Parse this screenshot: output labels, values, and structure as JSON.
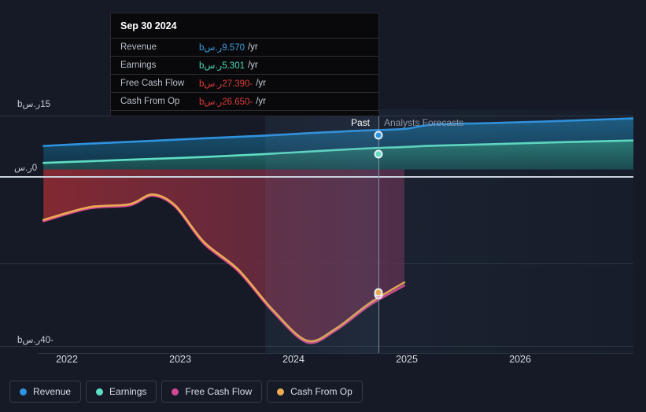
{
  "chart_data": {
    "type": "area",
    "title": "",
    "xlabel": "",
    "ylabel": "",
    "currency_symbol": "ر.س",
    "unit_suffix": "b",
    "period_suffix": "/yr",
    "xlim": [
      2021.55,
      2026.75
    ],
    "ylim": [
      -43.5,
      16.8
    ],
    "grid": true,
    "legend_position": "bottom-left",
    "x_ticks": [
      "2022",
      "2023",
      "2024",
      "2025",
      "2026"
    ],
    "x_tick_values": [
      2022,
      2023,
      2024,
      2025,
      2026
    ],
    "y_ticks": [
      "15ر.سb",
      "0ر.س",
      "-40ر.سb"
    ],
    "y_tick_values": [
      15,
      0,
      -40
    ],
    "y_gridlines": [
      15,
      0,
      -20,
      -40
    ],
    "forecast_start_x": 2024.75,
    "past_label": "Past",
    "forecast_label": "Analysts Forecasts",
    "series": [
      {
        "name": "Revenue",
        "color": "#2e93e0",
        "fill": "#163a52",
        "x": [
          2021.6,
          2022.0,
          2022.5,
          2023.0,
          2023.5,
          2024.0,
          2024.4,
          2024.75,
          2025.0,
          2025.5,
          2026.0,
          2026.75
        ],
        "values": [
          5.55,
          6.1,
          6.7,
          7.35,
          7.95,
          8.7,
          9.2,
          9.57,
          10.6,
          10.95,
          11.35,
          12.05
        ]
      },
      {
        "name": "Earnings",
        "color": "#5fdec4",
        "fill": "#1d5150",
        "x": [
          2021.6,
          2022.0,
          2022.5,
          2023.0,
          2023.5,
          2024.0,
          2024.4,
          2024.75,
          2025.0,
          2025.5,
          2026.0,
          2026.75
        ],
        "values": [
          1.55,
          1.95,
          2.45,
          2.95,
          3.6,
          4.35,
          4.95,
          5.301,
          5.6,
          5.95,
          6.35,
          6.85
        ]
      },
      {
        "name": "Free Cash Flow",
        "color": "#d6478f",
        "fill": "#7b2230",
        "x": [
          2021.6,
          2022.0,
          2022.35,
          2022.55,
          2022.75,
          2023.0,
          2023.3,
          2023.6,
          2023.9,
          2024.15,
          2024.45,
          2024.75
        ],
        "values": [
          -12.2,
          -9.2,
          -8.5,
          -6.2,
          -8.8,
          -17.5,
          -24.0,
          -33.5,
          -40.8,
          -38.0,
          -32.0,
          -27.39
        ]
      },
      {
        "name": "Cash From Op",
        "color": "#eaab52",
        "fill": "#7b2230",
        "x": [
          2021.6,
          2022.0,
          2022.35,
          2022.55,
          2022.75,
          2023.0,
          2023.3,
          2023.6,
          2023.9,
          2024.15,
          2024.45,
          2024.75
        ],
        "values": [
          -11.9,
          -8.9,
          -8.2,
          -5.9,
          -8.5,
          -17.1,
          -23.6,
          -33.1,
          -40.4,
          -37.6,
          -31.5,
          -26.65
        ]
      }
    ]
  },
  "tooltip": {
    "title": "Sep 30 2024",
    "rows": [
      {
        "label": "Revenue",
        "value": "9.570ر.سb",
        "unit": "/yr",
        "color": "#3d9bdf"
      },
      {
        "label": "Earnings",
        "value": "5.301ر.سb",
        "unit": "/yr",
        "color": "#4fd9b8"
      },
      {
        "label": "Free Cash Flow",
        "value": "-27.390ر.سb",
        "unit": "/yr",
        "color": "#e03c3c"
      },
      {
        "label": "Cash From Op",
        "value": "-26.650ر.سb",
        "unit": "/yr",
        "color": "#e03c3c"
      }
    ]
  },
  "legend": {
    "items": [
      {
        "label": "Revenue",
        "color": "#2e93e0"
      },
      {
        "label": "Earnings",
        "color": "#5fdec4"
      },
      {
        "label": "Free Cash Flow",
        "color": "#d6478f"
      },
      {
        "label": "Cash From Op",
        "color": "#eaab52"
      }
    ]
  },
  "axis": {
    "y_labels": [
      {
        "text": "15ر.سb",
        "y": 15
      },
      {
        "text": "0ر.س",
        "y": 0
      },
      {
        "text": "-40ر.سb",
        "y": -40
      }
    ],
    "x_labels": [
      "2022",
      "2023",
      "2024",
      "2025",
      "2026"
    ]
  },
  "colors": {
    "background": "#151a26",
    "grid": "#2c3442",
    "zero_line": "#c9d2de",
    "divider": "#7f8ea3",
    "negative_fill_top": "#8e2b34",
    "negative_fill_bottom": "#1b2232"
  }
}
